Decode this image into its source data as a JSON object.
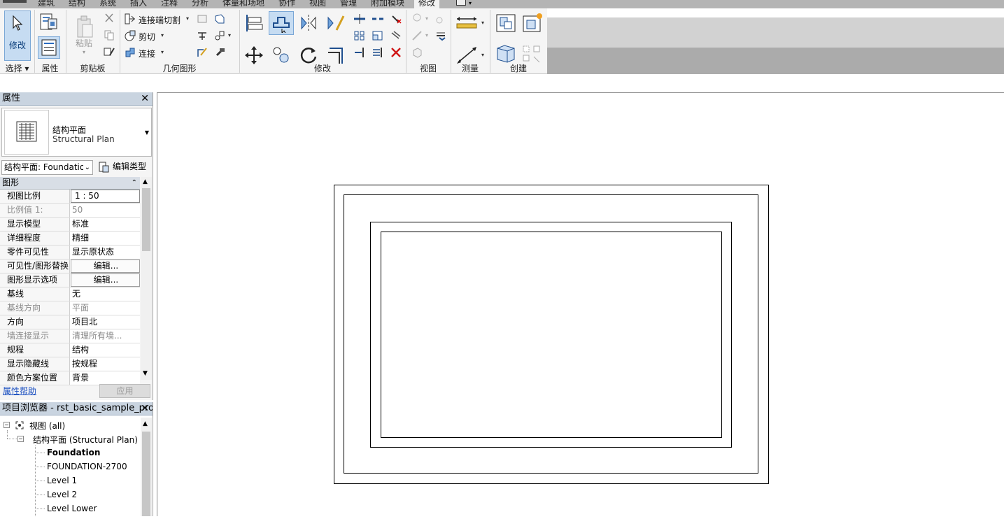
{
  "tabs": [
    "建筑",
    "结构",
    "系统",
    "插入",
    "注释",
    "分析",
    "体量和场地",
    "协作",
    "视图",
    "管理",
    "附加模块",
    "修改"
  ],
  "active_tab": "修改",
  "ribbon": {
    "modify_label": "修改",
    "clipboard": {
      "paste": "粘贴"
    },
    "geometry": {
      "cope": "连接端切割",
      "cut": "剪切",
      "join": "连接"
    },
    "panels": [
      "选择",
      "属性",
      "剪贴板",
      "几何图形",
      "修改",
      "视图",
      "测量",
      "创建"
    ]
  },
  "properties": {
    "title": "属性",
    "type_name_cn": "结构平面",
    "type_name_en": "Structural Plan",
    "instance_combo": "结构平面: Foundation",
    "edit_type": "编辑类型",
    "section": "图形",
    "rows": [
      {
        "k": "视图比例",
        "v": "1 : 50"
      },
      {
        "k": "比例值 1:",
        "v": "50"
      },
      {
        "k": "显示模型",
        "v": "标准"
      },
      {
        "k": "详细程度",
        "v": "精细"
      },
      {
        "k": "零件可见性",
        "v": "显示原状态"
      },
      {
        "k": "可见性/图形替换",
        "v": "编辑..."
      },
      {
        "k": "图形显示选项",
        "v": "编辑..."
      },
      {
        "k": "基线",
        "v": "无"
      },
      {
        "k": "基线方向",
        "v": "平面"
      },
      {
        "k": "方向",
        "v": "项目北"
      },
      {
        "k": "墙连接显示",
        "v": "清理所有墙..."
      },
      {
        "k": "规程",
        "v": "结构"
      },
      {
        "k": "显示隐藏线",
        "v": "按规程"
      },
      {
        "k": "颜色方案位置",
        "v": "背景"
      }
    ],
    "help": "属性帮助",
    "apply": "应用"
  },
  "browser": {
    "title": "项目浏览器 - rst_basic_sample_proj...",
    "root": "视图 (all)",
    "group": "结构平面 (Structural Plan)",
    "items": [
      "Foundation",
      "FOUNDATION-2700",
      "Level 1",
      "Level 2",
      "Level Lower"
    ],
    "active_item": "Foundation"
  },
  "colors": {
    "accent": "#c6dcf2",
    "title_bar": "#c9d4e0"
  }
}
